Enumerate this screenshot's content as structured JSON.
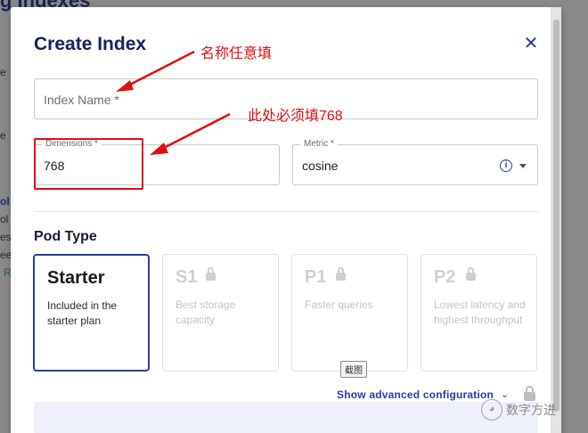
{
  "background": {
    "title": "g Indexes",
    "fragments": [
      "e",
      "e",
      "ol",
      "ol",
      "es",
      "ee",
      "R"
    ]
  },
  "modal": {
    "title": "Create Index",
    "close_icon": "close-icon"
  },
  "form": {
    "index_name": {
      "placeholder": "Index Name *",
      "value": ""
    },
    "dimensions": {
      "label": "Dimensions *",
      "value": "768"
    },
    "metric": {
      "label": "Metric *",
      "value": "cosine"
    }
  },
  "pod_type": {
    "title": "Pod Type",
    "options": [
      {
        "name": "Starter",
        "description": "Included in the starter plan",
        "selected": true,
        "locked": false
      },
      {
        "name": "S1",
        "description": "Best storage capacity",
        "selected": false,
        "locked": true
      },
      {
        "name": "P1",
        "description": "Faster queries",
        "selected": false,
        "locked": true
      },
      {
        "name": "P2",
        "description": "Lowest latency and highest throughput",
        "selected": false,
        "locked": true
      }
    ]
  },
  "tooltip": "截图",
  "advanced": {
    "label": "Show advanced configuration",
    "chevron": "⌄"
  },
  "annotations": {
    "name_note": "名称任意填",
    "dimension_note": "此处必须填768",
    "color": "#e01010"
  },
  "watermark": {
    "icon": "wechat-icon",
    "text": "数字方进"
  },
  "colors": {
    "accent": "#2b3aa8",
    "title": "#1a2160"
  }
}
